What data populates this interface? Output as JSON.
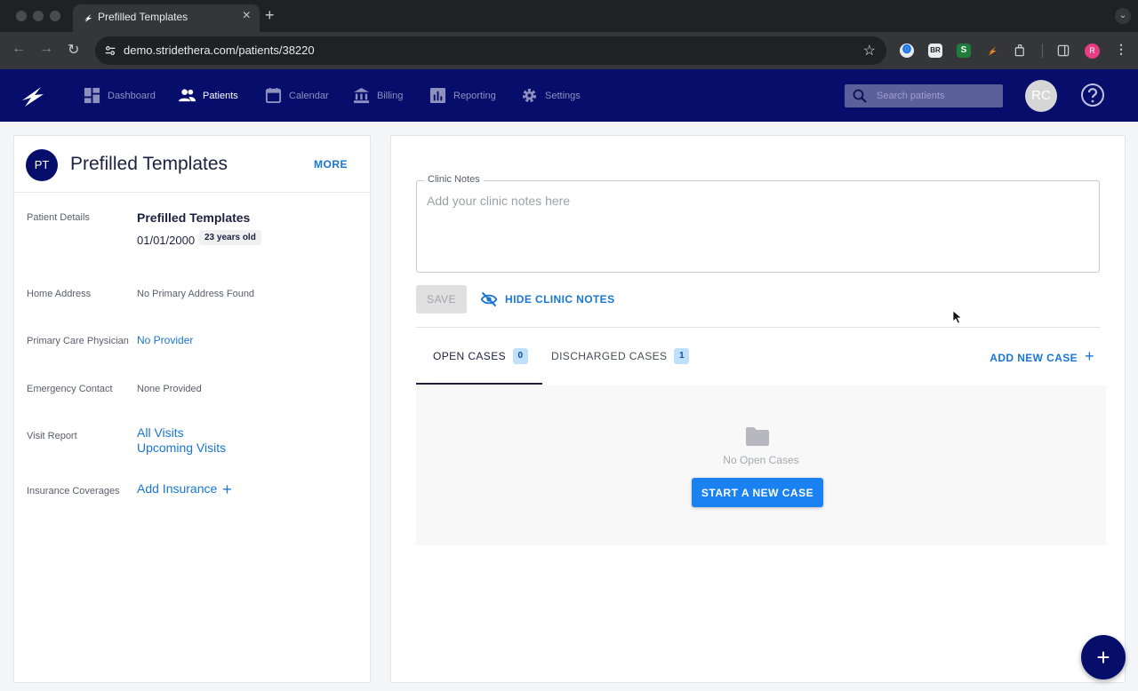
{
  "browser": {
    "tab_title": "Prefilled Templates",
    "tab_close": "×",
    "new_tab": "+",
    "url": "demo.stridethera.com/patients/38220",
    "extensions": [
      "1password-icon",
      "br-extension-icon",
      "s-extension-icon",
      "stride-extension-icon",
      "puzzle-icon"
    ],
    "ext_labels": {
      "br": "BR",
      "s": "S"
    },
    "profile_initial": "R",
    "colors": {
      "chrome_bg": "#202124",
      "toolbar_bg": "#35363a"
    }
  },
  "nav": {
    "items": [
      {
        "label": "Dashboard",
        "icon": "dashboard-icon"
      },
      {
        "label": "Patients",
        "icon": "people-icon",
        "active": true
      },
      {
        "label": "Calendar",
        "icon": "calendar-icon"
      },
      {
        "label": "Billing",
        "icon": "bank-icon"
      },
      {
        "label": "Reporting",
        "icon": "bar-chart-icon"
      },
      {
        "label": "Settings",
        "icon": "gear-icon"
      }
    ],
    "search_placeholder": "Search patients",
    "user_initials": "RC",
    "colors": {
      "appbar": "#070d6b",
      "search_bg": "#5b5f9a"
    }
  },
  "patient": {
    "initials": "PT",
    "name": "Prefilled Templates",
    "more_label": "MORE",
    "details_label": "Patient Details",
    "details_name": "Prefilled Templates",
    "dob": "01/01/2000",
    "age": "23 years old",
    "home_address_label": "Home Address",
    "home_address_value": "No Primary Address Found",
    "pcp_label": "Primary Care Physician",
    "pcp_value": "No Provider",
    "emergency_label": "Emergency Contact",
    "emergency_value": "None Provided",
    "visit_report_label": "Visit Report",
    "all_visits": "All Visits",
    "upcoming_visits": "Upcoming Visits",
    "insurance_label": "Insurance Coverages",
    "add_insurance": "Add Insurance"
  },
  "notes": {
    "legend": "Clinic Notes",
    "placeholder": "Add your clinic notes here",
    "save_label": "SAVE",
    "hide_label": "HIDE CLINIC NOTES"
  },
  "cases": {
    "tabs": [
      {
        "label": "OPEN CASES",
        "count": "0",
        "active": true
      },
      {
        "label": "DISCHARGED CASES",
        "count": "1"
      }
    ],
    "add_label": "ADD NEW CASE",
    "empty_text": "No Open Cases",
    "start_label": "START A NEW CASE",
    "colors": {
      "accent": "#1976d2",
      "start_button": "#1a82f0",
      "count_badge": "#bfe0fb"
    }
  },
  "fab_label": "+"
}
